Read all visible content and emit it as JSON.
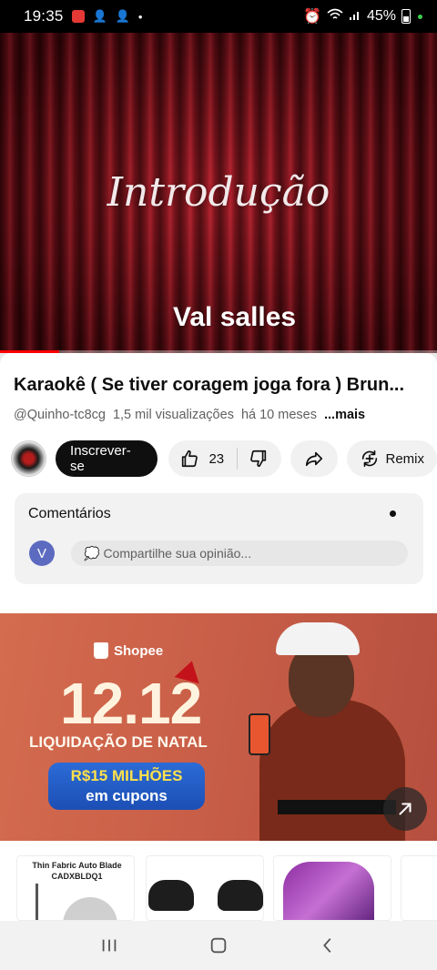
{
  "status_bar": {
    "time": "19:35",
    "battery": "45%"
  },
  "video": {
    "overlay_title": "Introdução",
    "caption": "Val  salles",
    "progress": 0.135
  },
  "details": {
    "title": "Karaokê ( Se tiver coragem joga fora ) Brun...",
    "channel": "@Quinho-tc8cg",
    "views": "1,5 mil visualizações",
    "age": "há 10 meses",
    "more": "...mais"
  },
  "actions": {
    "subscribe": "Inscrever-se",
    "likes": "23",
    "remix": "Remix"
  },
  "comments": {
    "title": "Comentários",
    "avatar_letter": "V",
    "placeholder": "Compartilhe sua opinião..."
  },
  "ad": {
    "brand": "Shopee",
    "date": "12.12",
    "headline": "LIQUIDAÇÃO DE NATAL",
    "promo_line1": "R$15 MILHÕES",
    "promo_line2": "em cupons"
  },
  "products": [
    {
      "label": "Thin Fabric Auto Blade CADXBLDQ1"
    }
  ],
  "colors": {
    "accent_red": "#ff0000",
    "subscribe_bg": "#0f0f0f",
    "ad_bg": "#c95f48",
    "promo_blue": "#2c6bd6"
  }
}
